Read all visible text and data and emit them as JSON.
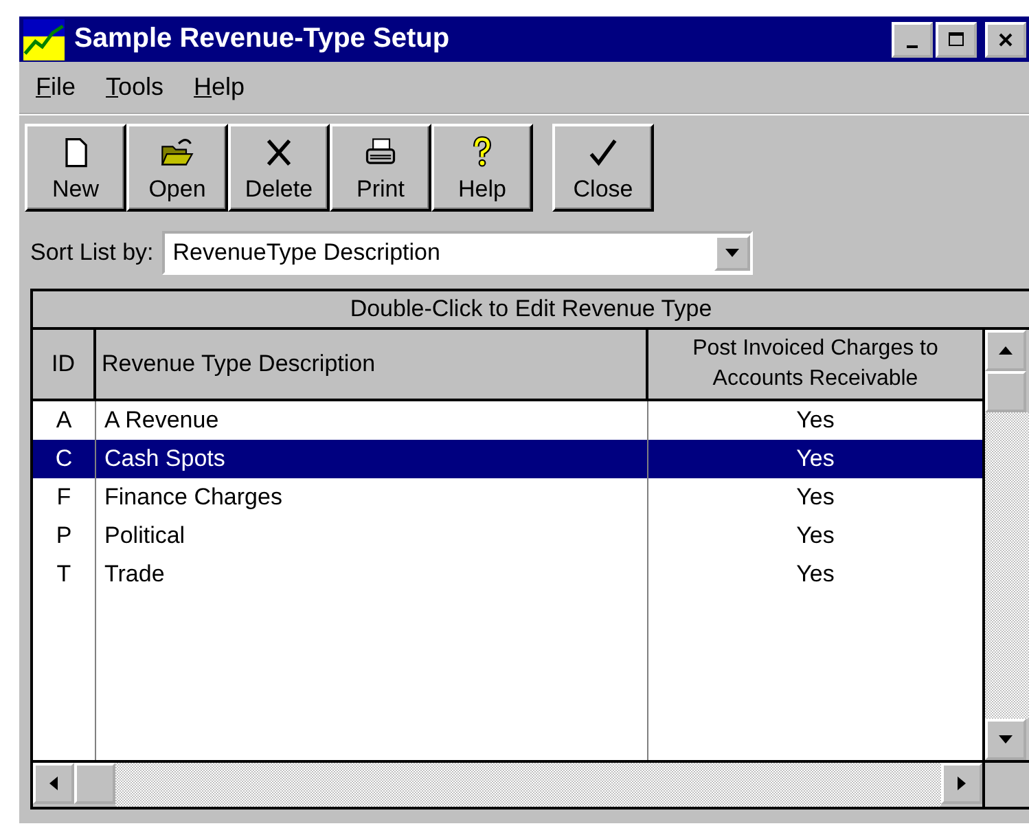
{
  "window": {
    "title": "Sample Revenue-Type Setup"
  },
  "menu": [
    {
      "label": "File"
    },
    {
      "label": "Tools"
    },
    {
      "label": "Help"
    }
  ],
  "toolbar": [
    {
      "kind": "new",
      "label": "New"
    },
    {
      "kind": "open",
      "label": "Open"
    },
    {
      "kind": "delete",
      "label": "Delete"
    },
    {
      "kind": "print",
      "label": "Print"
    },
    {
      "kind": "help",
      "label": "Help"
    },
    {
      "kind": "close",
      "label": "Close"
    }
  ],
  "sort": {
    "label": "Sort List by:",
    "value": "RevenueType Description"
  },
  "table": {
    "caption": "Double-Click to Edit Revenue Type",
    "columns": [
      "ID",
      "Revenue Type Description",
      "Post Invoiced Charges to Accounts Receivable"
    ],
    "rows": [
      {
        "id": "A",
        "description": "A Revenue",
        "post": "Yes",
        "selected": false
      },
      {
        "id": "C",
        "description": "Cash Spots",
        "post": "Yes",
        "selected": true
      },
      {
        "id": "F",
        "description": "Finance Charges",
        "post": "Yes",
        "selected": false
      },
      {
        "id": "P",
        "description": "Political",
        "post": "Yes",
        "selected": false
      },
      {
        "id": "T",
        "description": "Trade",
        "post": "Yes",
        "selected": false
      }
    ]
  }
}
